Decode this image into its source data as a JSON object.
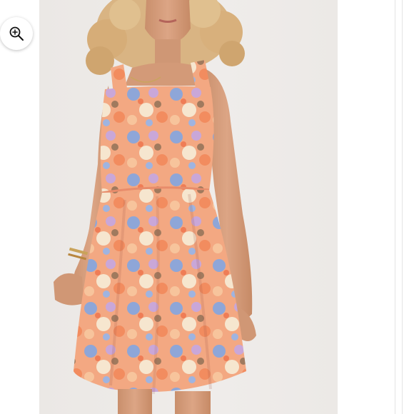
{
  "viewer": {
    "zoom_button": {
      "icon": "zoom-in-icon",
      "label": ""
    }
  },
  "product_image": {
    "description_visible_text": "",
    "colors": {
      "background": "#ecE9e6",
      "dress_base": "#f4a27c",
      "floral_blue": "#8ea6d8",
      "floral_lilac": "#c9a7d8",
      "floral_cream": "#f6e6cf",
      "hair": "#d9b483",
      "skin": "#d9a07e"
    }
  }
}
